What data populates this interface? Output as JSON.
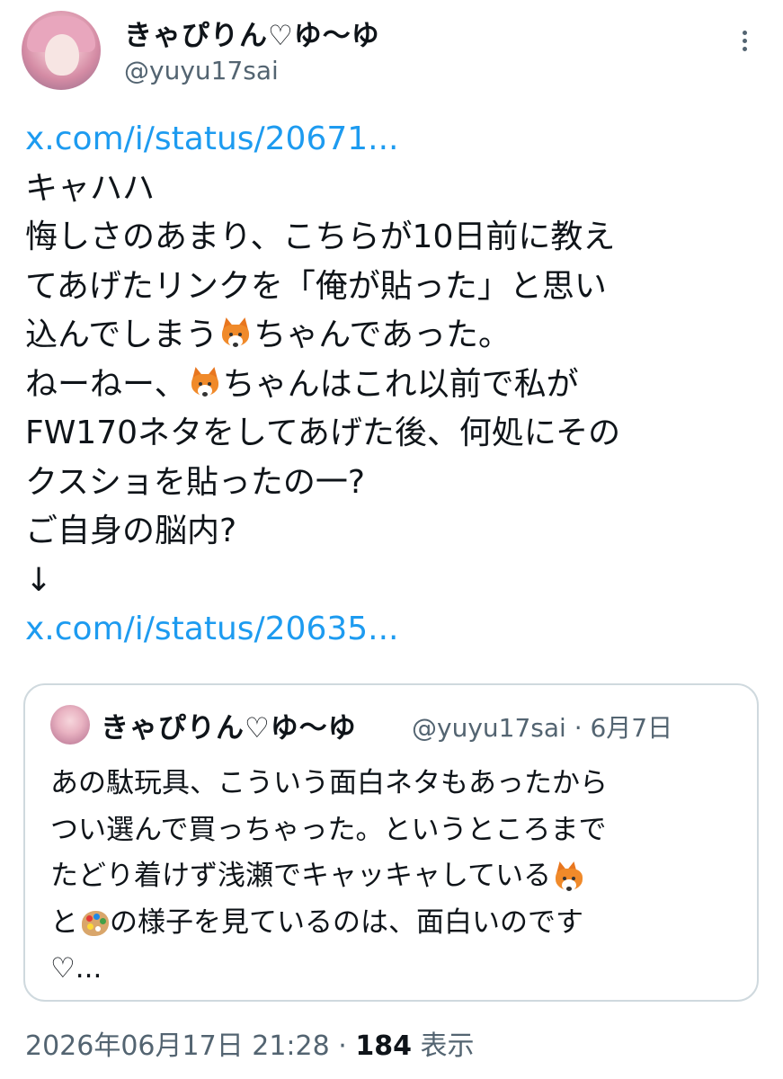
{
  "tweet": {
    "author_name": "きゃぴりん♡ゆ〜ゆ",
    "author_handle": "@yuyu17sai",
    "lines": [
      "キャハハ",
      "悔しさのあまり、こちらが10日前に教え",
      "てあげたリンクを「俺が貼った」と思い",
      "込んでしまう",
      "ちゃんであった。",
      "ねーねー、",
      "ちゃんはこれ以前で私が",
      "FW170ネタをしてあげた後、何処にその",
      "クスショを貼ったの一?",
      "ご自身の脳内?",
      "↓"
    ],
    "link_top": "x.com/i/status/20671...",
    "link_bottom": "x.com/i/status/20635...",
    "timestamp": "2026年06月17日 21:28",
    "separator": "·",
    "views_count": "184",
    "views_label": "表示"
  },
  "quoted": {
    "author_name": "きゃぴりん♡ゆ〜ゆ",
    "handle_and_date": "@yuyu17sai · 6月7日",
    "lines": [
      "あの駄玩具、こういう面白ネタもあったから",
      "つい選んで買っちゃった。というところまで",
      "たどり着けず浅瀬でキャッキャしている",
      "と",
      "の様子を見ているのは、面白いのです",
      "♡..."
    ]
  },
  "icons": {
    "more": "more-vertical-icon",
    "fox": "fox-emoji-icon",
    "palette": "artist-palette-emoji-icon"
  }
}
